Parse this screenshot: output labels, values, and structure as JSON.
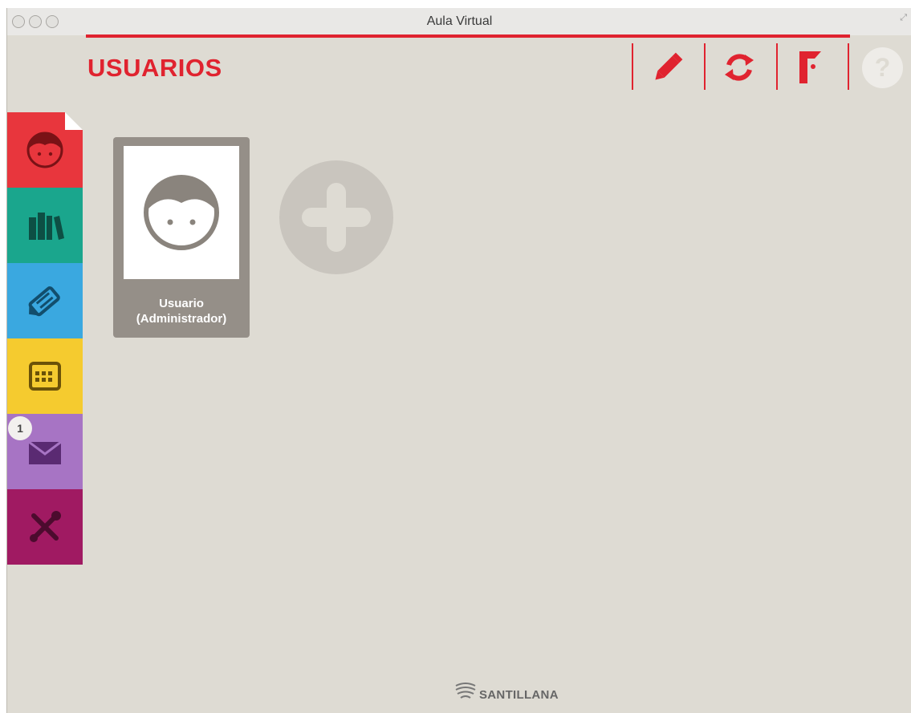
{
  "window": {
    "title": "Aula Virtual"
  },
  "header": {
    "title": "USUARIOS",
    "accent_color": "#e0232f",
    "tools": [
      {
        "name": "edit",
        "icon": "pencil-icon"
      },
      {
        "name": "sync",
        "icon": "refresh-icon"
      },
      {
        "name": "flag",
        "icon": "flag-icon"
      }
    ],
    "help_label": "?"
  },
  "sidebar": {
    "items": [
      {
        "id": "users",
        "icon": "user-face-icon",
        "color": "#e8363d",
        "active": true
      },
      {
        "id": "library",
        "icon": "books-icon",
        "color": "#1aa68d"
      },
      {
        "id": "notes",
        "icon": "pencil-tag-icon",
        "color": "#3aa8e0"
      },
      {
        "id": "calendar",
        "icon": "calendar-icon",
        "color": "#f5cb2f"
      },
      {
        "id": "messages",
        "icon": "envelope-icon",
        "color": "#a774c4",
        "badge": "1"
      },
      {
        "id": "settings",
        "icon": "tools-icon",
        "color": "#a01a62"
      }
    ]
  },
  "users": [
    {
      "name_line1": "Usuario",
      "name_line2": "(Administrador)"
    }
  ],
  "footer": {
    "brand": "SANTILLANA"
  }
}
